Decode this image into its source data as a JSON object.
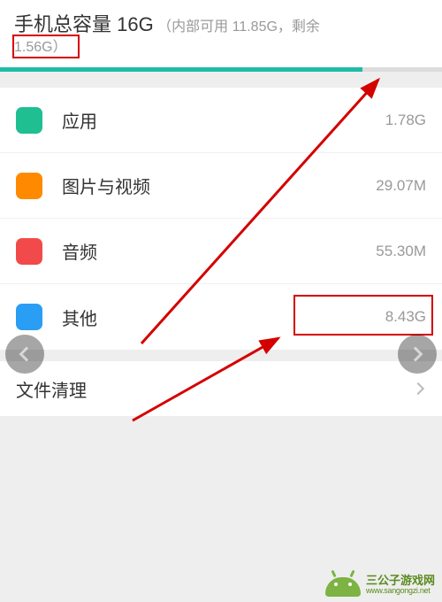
{
  "header": {
    "title_prefix": "手机总容量 ",
    "total": "16G",
    "detail_prefix": "（内部可用 ",
    "internal": "11.85G",
    "detail_mid": "，剩余",
    "remaining": "1.56G",
    "detail_suffix": "）"
  },
  "progress": {
    "percent": 82
  },
  "categories": [
    {
      "label": "应用",
      "value": "1.78G",
      "color": "green"
    },
    {
      "label": "图片与视频",
      "value": "29.07M",
      "color": "orange"
    },
    {
      "label": "音频",
      "value": "55.30M",
      "color": "red"
    },
    {
      "label": "其他",
      "value": "8.43G",
      "color": "blue"
    }
  ],
  "cleanup": {
    "label": "文件清理"
  },
  "watermark": {
    "name": "三公子游戏网",
    "url": "www.sangongzi.net"
  }
}
